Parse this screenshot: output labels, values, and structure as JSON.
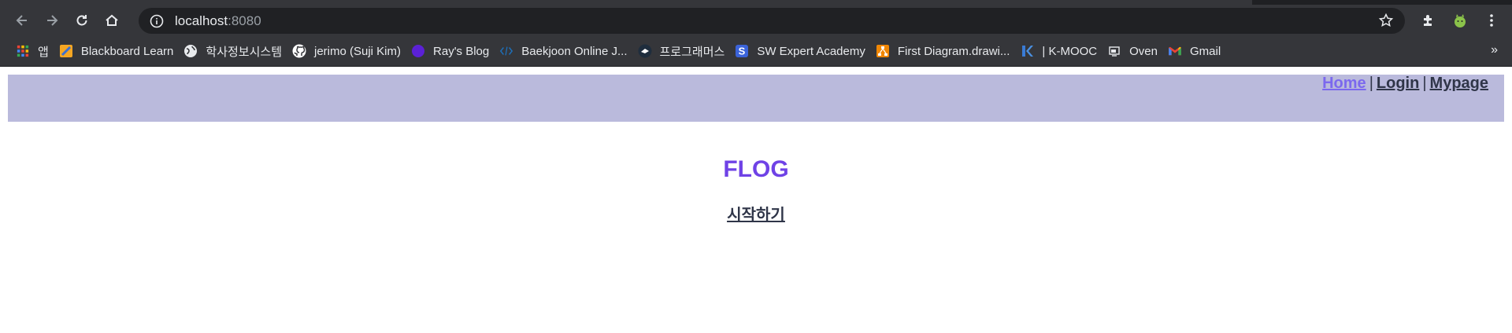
{
  "browser": {
    "url_host": "localhost",
    "url_port": ":8080",
    "bookmarks": [
      {
        "label": "앱",
        "icon": "apps-grid-icon"
      },
      {
        "label": "Blackboard Learn",
        "icon": "blackboard-icon"
      },
      {
        "label": "학사정보시스템",
        "icon": "globe-icon"
      },
      {
        "label": "jerimo (Suji Kim)",
        "icon": "github-icon"
      },
      {
        "label": "Ray's Blog",
        "icon": "blog-circle-icon"
      },
      {
        "label": "Baekjoon Online J...",
        "icon": "code-icon"
      },
      {
        "label": "프로그래머스",
        "icon": "programmers-icon"
      },
      {
        "label": "SW Expert Academy",
        "icon": "swea-icon"
      },
      {
        "label": "First Diagram.drawi...",
        "icon": "drawio-icon"
      },
      {
        "label": "| K-MOOC",
        "icon": "kmooc-icon"
      },
      {
        "label": "Oven",
        "icon": "oven-icon"
      },
      {
        "label": "Gmail",
        "icon": "gmail-icon"
      }
    ],
    "more": "»"
  },
  "nav": {
    "home": "Home",
    "login": "Login",
    "mypage": "Mypage",
    "separator": "|"
  },
  "main": {
    "title": "FLOG",
    "start_link": "시작하기"
  },
  "colors": {
    "header_bg": "#babadc",
    "title": "#6f42e6",
    "home_link": "#7b68ee"
  }
}
